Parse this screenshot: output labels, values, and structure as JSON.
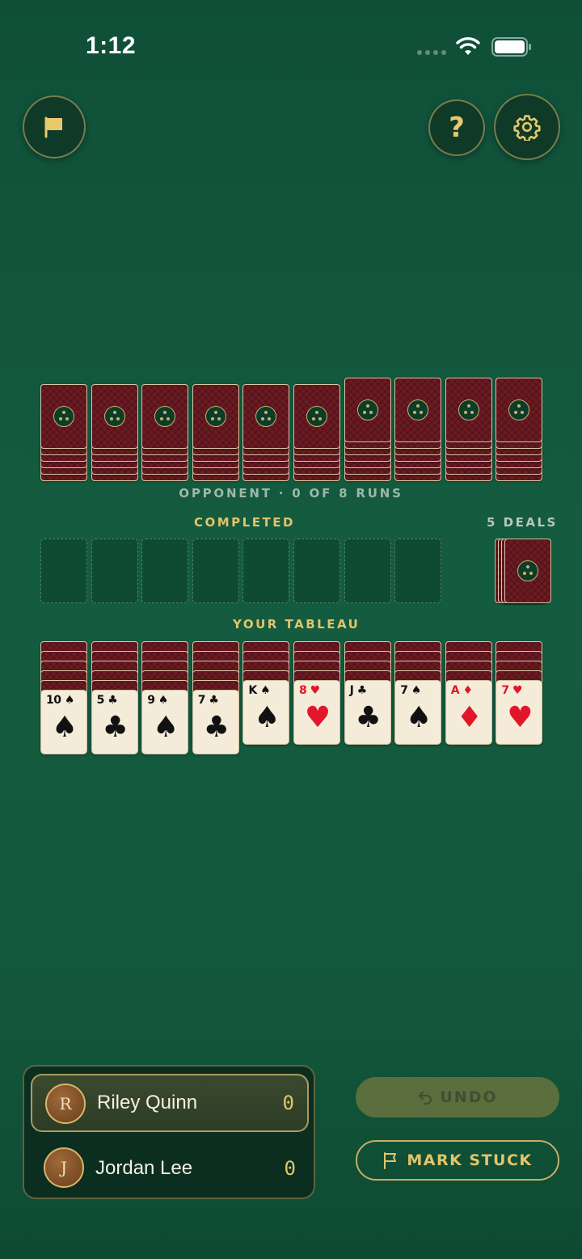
{
  "status_bar": {
    "time": "1:12"
  },
  "top_bar": {
    "help_label": "?"
  },
  "opponent": {
    "label": "OPPONENT · 0 OF 8 RUNS",
    "pile_stub_counts": [
      5,
      5,
      5,
      5,
      5,
      5,
      6,
      6,
      6,
      6
    ]
  },
  "completed": {
    "label": "COMPLETED",
    "slots": 8
  },
  "deals": {
    "label": "5 DEALS"
  },
  "tableau": {
    "label": "YOUR TABLEAU",
    "columns": [
      {
        "hidden": 5,
        "rank": "10",
        "suit": "♠",
        "color": "black"
      },
      {
        "hidden": 5,
        "rank": "5",
        "suit": "♣",
        "color": "black"
      },
      {
        "hidden": 5,
        "rank": "9",
        "suit": "♠",
        "color": "black"
      },
      {
        "hidden": 5,
        "rank": "7",
        "suit": "♣",
        "color": "black"
      },
      {
        "hidden": 4,
        "rank": "K",
        "suit": "♠",
        "color": "black"
      },
      {
        "hidden": 4,
        "rank": "8",
        "suit": "♥",
        "color": "red"
      },
      {
        "hidden": 4,
        "rank": "J",
        "suit": "♣",
        "color": "black"
      },
      {
        "hidden": 4,
        "rank": "7",
        "suit": "♠",
        "color": "black"
      },
      {
        "hidden": 4,
        "rank": "A",
        "suit": "♦",
        "color": "red"
      },
      {
        "hidden": 4,
        "rank": "7",
        "suit": "♥",
        "color": "red"
      }
    ]
  },
  "players": [
    {
      "initial": "R",
      "name": "Riley Quinn",
      "score": "0",
      "active": true
    },
    {
      "initial": "J",
      "name": "Jordan Lee",
      "score": "0",
      "active": false
    }
  ],
  "actions": {
    "undo_label": "UNDO",
    "stuck_label": "MARK STUCK"
  },
  "colors": {
    "felt": "#145c40",
    "gold": "#e3c46a",
    "card_back": "#6b1a22",
    "red_suit": "#e2162b"
  }
}
